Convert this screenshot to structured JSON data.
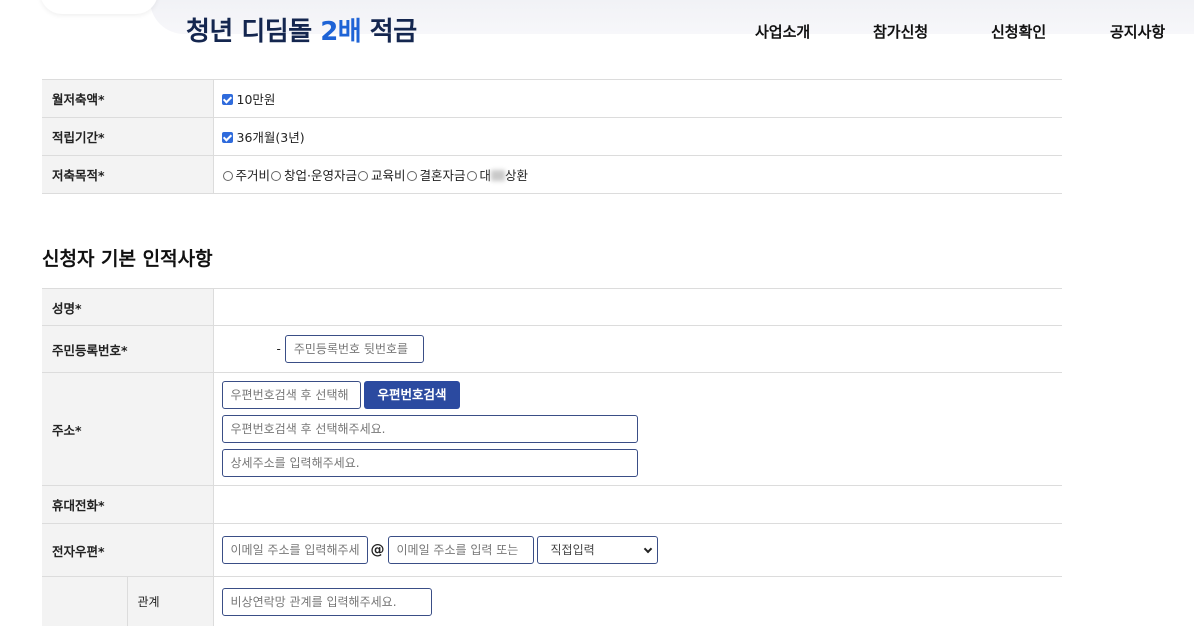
{
  "header": {
    "logo_main": "청년 디딤돌 ",
    "logo_highlight": "2배",
    "logo_tail": " 적금",
    "nav": [
      "사업소개",
      "참가신청",
      "신청확인",
      "공지사항"
    ]
  },
  "savings": {
    "monthly_label": "월저축액*",
    "monthly_value": "10만원",
    "period_label": "적립기간*",
    "period_value": "36개월(3년)",
    "purpose_label": "저축목적*",
    "purpose_options": [
      "주거비",
      "창업·운영자금",
      "교육비",
      "결혼자금",
      "대",
      "상환"
    ]
  },
  "section_title": "신청자 기본 인적사항",
  "applicant": {
    "name_label": "성명*",
    "rrn_label": "주민등록번호*",
    "rrn_dash": "-",
    "rrn_placeholder": "주민등록번호 뒷번호를",
    "address_label": "주소*",
    "zipcode_placeholder": "우편번호검색 후 선택해",
    "zipcode_button": "우편번호검색",
    "address1_placeholder": "우편번호검색 후 선택해주세요.",
    "address2_placeholder": "상세주소를 입력해주세요.",
    "phone_label": "휴대전화*",
    "email_label": "전자우편*",
    "email_id_placeholder": "이메일 주소를 입력해주세",
    "email_at": "@",
    "email_domain_placeholder": "이메일 주소를 입력 또는",
    "email_select_value": "직접입력",
    "relation_label": "관계",
    "relation_placeholder": "비상연락망 관계를 입력해주세요."
  },
  "colors": {
    "brand_navy": "#14264f",
    "brand_blue": "#1e63d6",
    "button_blue": "#2b4aa0",
    "checkbox_blue": "#2f6bdc"
  }
}
